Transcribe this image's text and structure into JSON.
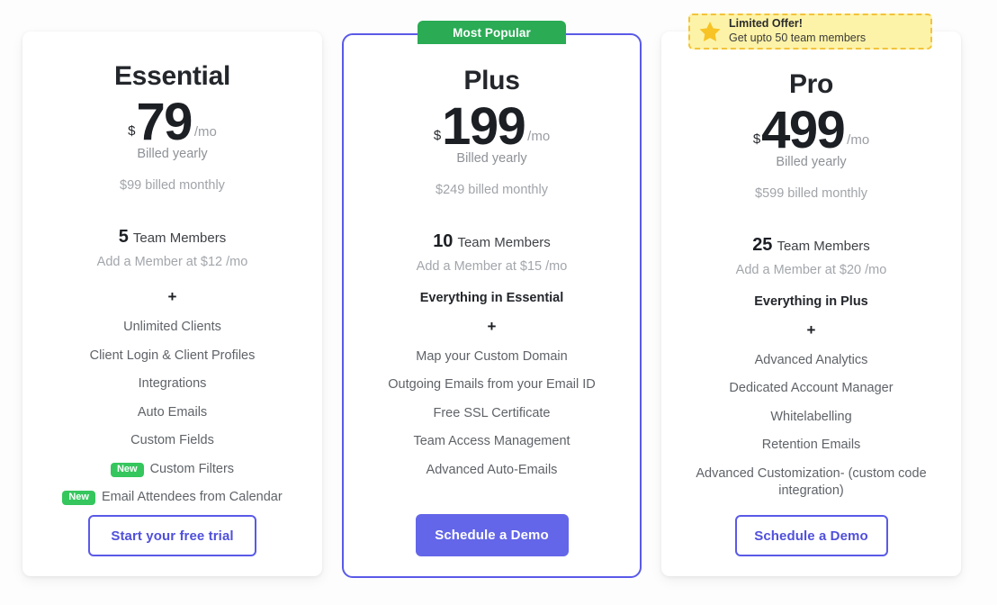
{
  "colors": {
    "accent_purple": "#5a5ae8",
    "badge_green": "#2aab54",
    "new_green": "#35c65d",
    "offer_yellow_bg": "#fdf3a8",
    "offer_yellow_border": "#f2c33c",
    "star_gold": "#f7c325",
    "cta_filled": "#6366e8",
    "text_dark": "#1c1f24",
    "text_muted": "#8d9196"
  },
  "badges": {
    "most_popular": "Most Popular",
    "limited_offer": {
      "icon": "star-icon",
      "title": "Limited Offer!",
      "subtitle": "Get upto 50 team members"
    }
  },
  "plans": [
    {
      "id": "essential",
      "name": "Essential",
      "currency": "$",
      "amount": "79",
      "period": "/mo",
      "billed": "Billed yearly",
      "monthly_note": "$99 billed monthly",
      "members_count": "5",
      "members_label": "Team Members",
      "members_addon": "Add a Member at $12 /mo",
      "features": [
        {
          "text": "+",
          "style": "plus-sign"
        },
        {
          "text": "Unlimited Clients",
          "style": "normal"
        },
        {
          "text": "Client Login & Client Profiles",
          "style": "normal"
        },
        {
          "text": "Integrations",
          "style": "normal"
        },
        {
          "text": "Auto Emails",
          "style": "normal"
        },
        {
          "text": "Custom Fields",
          "style": "normal"
        },
        {
          "text": "Custom Filters",
          "style": "normal",
          "badge": "New"
        },
        {
          "text": "Email Attendees from Calendar",
          "style": "normal",
          "badge": "New"
        }
      ],
      "cta": {
        "label": "Start your free trial",
        "variant": "outline"
      }
    },
    {
      "id": "plus",
      "name": "Plus",
      "currency": "$",
      "amount": "199",
      "period": "/mo",
      "billed": "Billed yearly",
      "monthly_note": "$249 billed monthly",
      "members_count": "10",
      "members_label": "Team Members",
      "members_addon": "Add a Member at $15 /mo",
      "features": [
        {
          "text": "Everything in Essential",
          "style": "everything"
        },
        {
          "text": "+",
          "style": "plus-sign"
        },
        {
          "text": "Map your Custom Domain",
          "style": "normal"
        },
        {
          "text": "Outgoing Emails from your Email ID",
          "style": "normal"
        },
        {
          "text": "Free SSL Certificate",
          "style": "normal"
        },
        {
          "text": "Team Access Management",
          "style": "normal"
        },
        {
          "text": "Advanced Auto-Emails",
          "style": "normal"
        }
      ],
      "cta": {
        "label": "Schedule a Demo",
        "variant": "filled"
      }
    },
    {
      "id": "pro",
      "name": "Pro",
      "currency": "$",
      "amount": "499",
      "period": "/mo",
      "billed": "Billed yearly",
      "monthly_note": "$599 billed monthly",
      "members_count": "25",
      "members_label": "Team Members",
      "members_addon": "Add a Member at $20 /mo",
      "features": [
        {
          "text": "Everything in Plus",
          "style": "everything"
        },
        {
          "text": "+",
          "style": "plus-sign"
        },
        {
          "text": "Advanced Analytics",
          "style": "normal"
        },
        {
          "text": "Dedicated Account Manager",
          "style": "normal"
        },
        {
          "text": "Whitelabelling",
          "style": "normal"
        },
        {
          "text": "Retention Emails",
          "style": "normal"
        },
        {
          "text": "Advanced Customization- (custom code integration)",
          "style": "normal"
        }
      ],
      "cta": {
        "label": "Schedule a Demo",
        "variant": "outline"
      }
    }
  ]
}
